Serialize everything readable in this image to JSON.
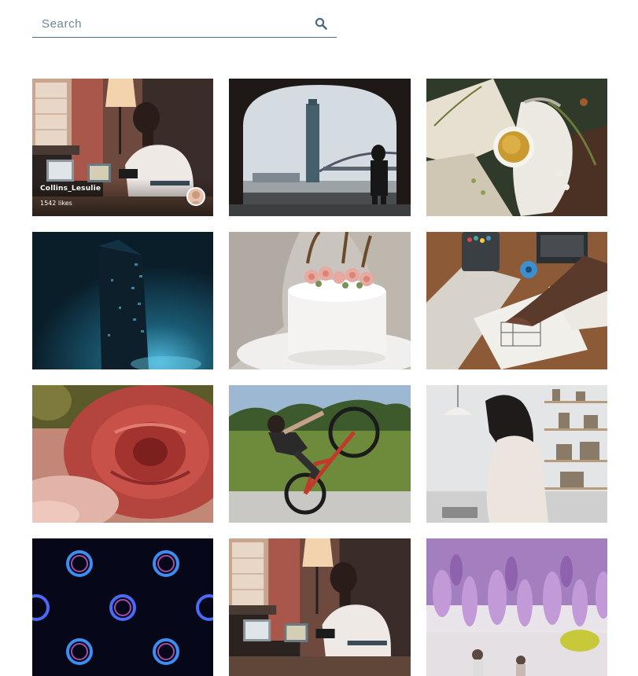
{
  "search": {
    "placeholder": "Search",
    "value": "",
    "icon": "search-icon"
  },
  "gallery": {
    "hover_card": {
      "username": "Collins_Lesulie",
      "likes": "1542 likes"
    },
    "photos": [
      {
        "subject": "man-at-desk-with-laptop"
      },
      {
        "subject": "city-tower-through-arch"
      },
      {
        "subject": "tea-cup-on-table"
      },
      {
        "subject": "skyscraper-at-night"
      },
      {
        "subject": "white-cake-with-roses"
      },
      {
        "subject": "hand-drawing-sketches"
      },
      {
        "subject": "red-rose"
      },
      {
        "subject": "bmx-wheelie"
      },
      {
        "subject": "woman-by-shelves"
      },
      {
        "subject": "glowing-rings-pattern"
      },
      {
        "subject": "man-at-desk-with-laptop"
      },
      {
        "subject": "purple-wisteria"
      }
    ]
  },
  "colors": {
    "search_underline": "#4a6d82",
    "search_icon": "#4a6d82"
  }
}
